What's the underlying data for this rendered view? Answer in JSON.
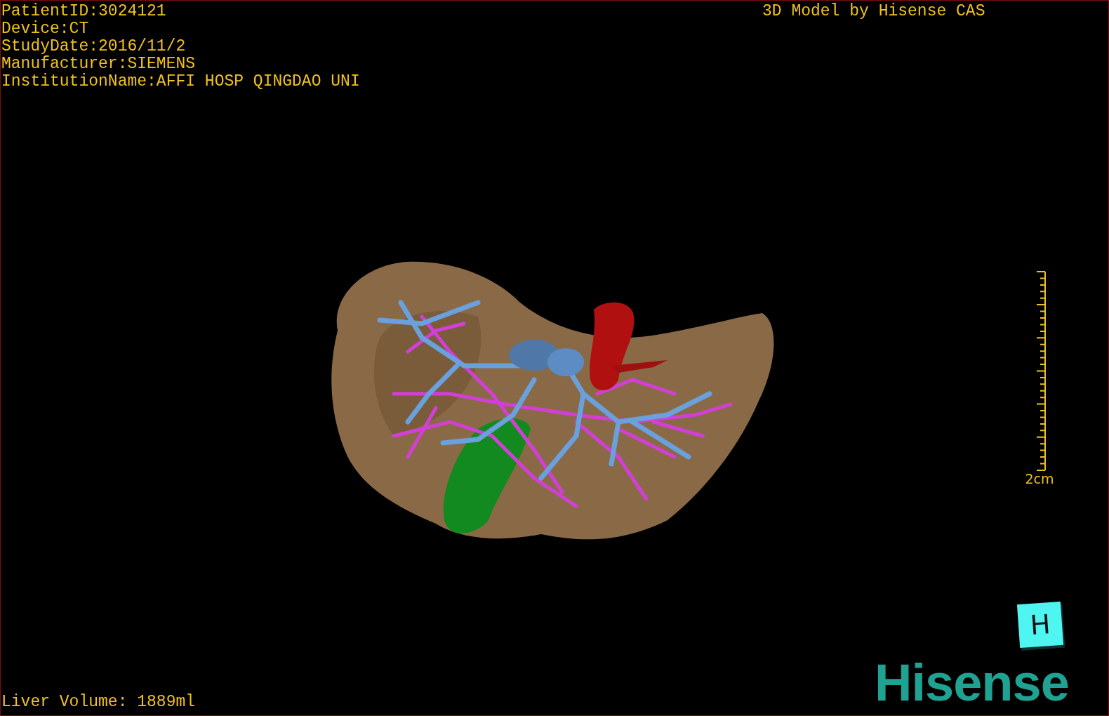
{
  "study_info": [
    "PatientID:3024121",
    "Device:CT",
    "StudyDate:2016/11/2",
    "Manufacturer:SIEMENS",
    "InstitutionName:AFFI HOSP QINGDAO UNI"
  ],
  "caption": "3D Model by Hisense CAS",
  "scale_bar": {
    "label": "2cm"
  },
  "orientation_marker": {
    "label": "H"
  },
  "logo": "Hisense",
  "liver_volume": "Liver Volume: 1889ml"
}
